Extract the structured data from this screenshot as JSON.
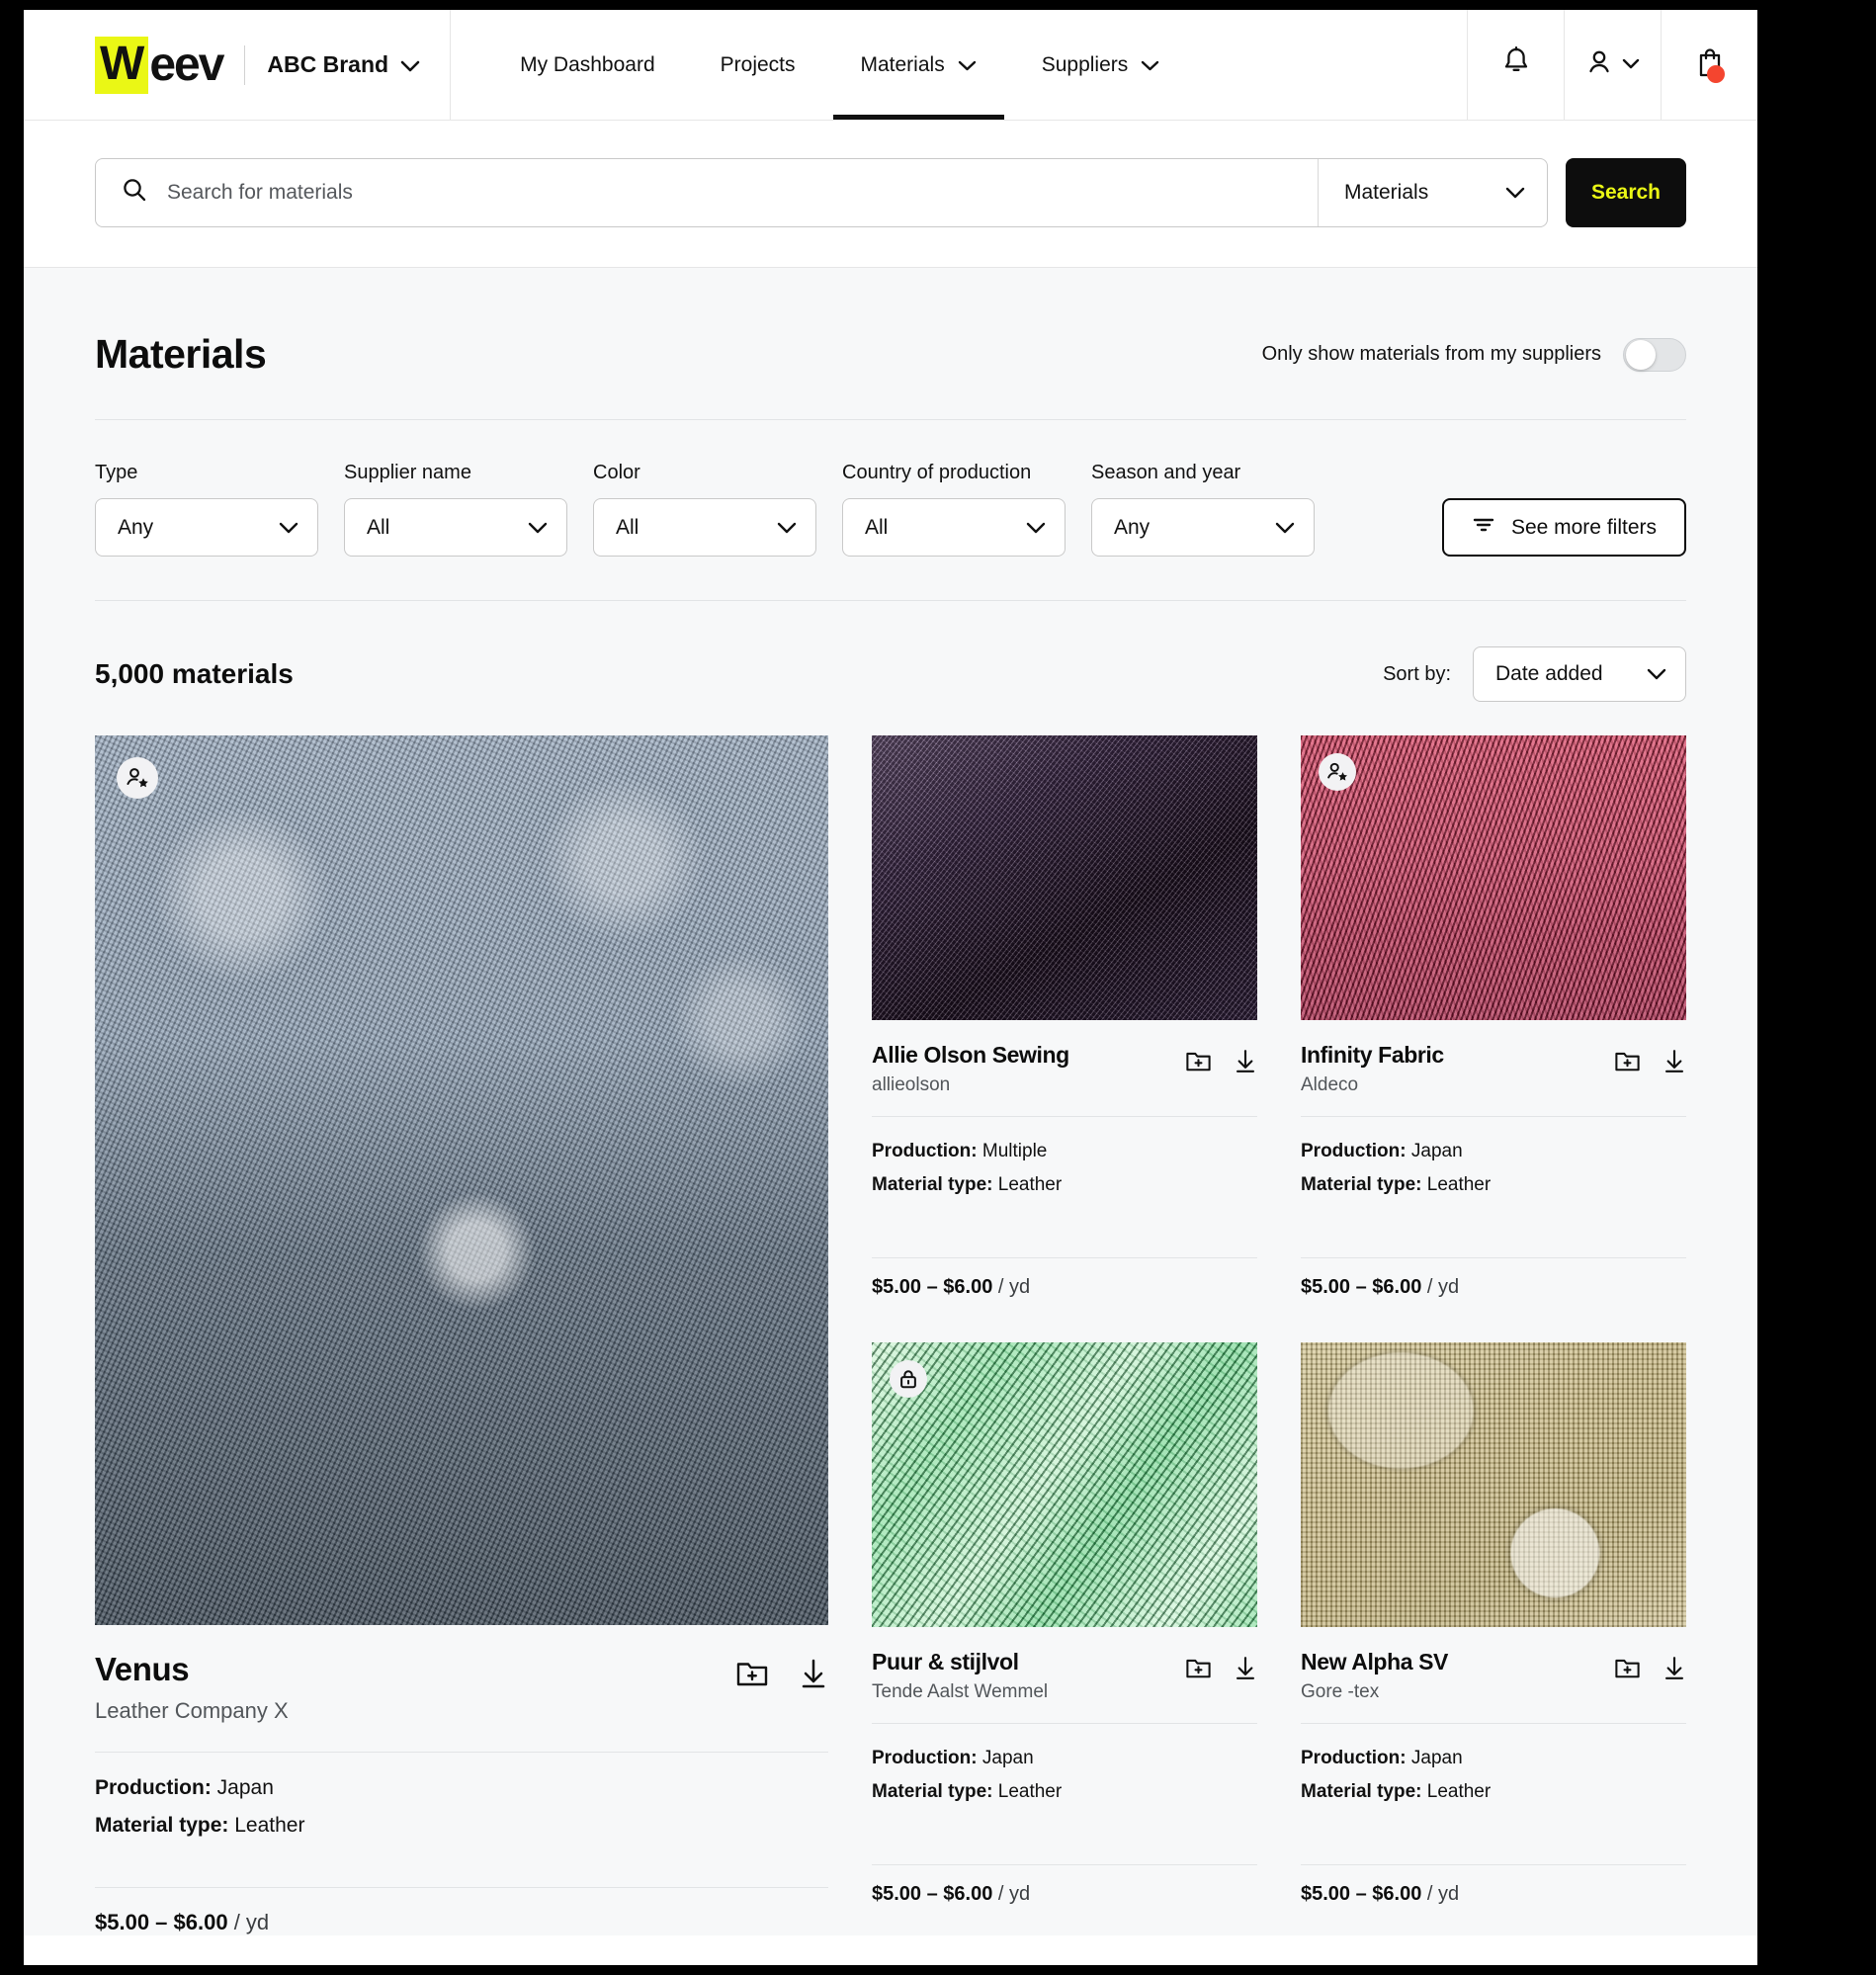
{
  "header": {
    "logo_highlight": "W",
    "logo_rest": "eev",
    "brand": "ABC Brand",
    "nav": [
      {
        "label": "My Dashboard",
        "has_chevron": false,
        "active": false
      },
      {
        "label": "Projects",
        "has_chevron": false,
        "active": false
      },
      {
        "label": "Materials",
        "has_chevron": true,
        "active": true
      },
      {
        "label": "Suppliers",
        "has_chevron": true,
        "active": false
      }
    ],
    "icons": [
      {
        "name": "bell-icon",
        "label": "Notifications"
      },
      {
        "name": "user-icon",
        "label": "Account"
      },
      {
        "name": "bag-icon",
        "label": "Cart",
        "badge": true
      }
    ],
    "accent_yellow": "#eaf715",
    "badge_red": "#f4452f"
  },
  "search": {
    "placeholder": "Search for materials",
    "scope_value": "Materials",
    "button_label": "Search"
  },
  "page": {
    "title": "Materials",
    "supplier_toggle_label": "Only show materials from my suppliers",
    "supplier_toggle_on": false
  },
  "filters": [
    {
      "label": "Type",
      "value": "Any"
    },
    {
      "label": "Supplier name",
      "value": "All"
    },
    {
      "label": "Color",
      "value": "All"
    },
    {
      "label": "Country of production",
      "value": "All"
    },
    {
      "label": "Season and year",
      "value": "Any"
    }
  ],
  "more_filters_label": "See more filters",
  "results": {
    "count_label": "5,000 materials",
    "sort_label": "Sort by:",
    "sort_value": "Date added"
  },
  "labels": {
    "production": "Production:",
    "material_type": "Material type:",
    "unit": "/ yd",
    "add_to_folder": "Add to folder",
    "download": "Download"
  },
  "materials": [
    {
      "name": "Venus",
      "supplier": "Leather Company X",
      "production": "Japan",
      "material_type": "Leather",
      "price": "$5.00 – $6.00",
      "unit": "/ yd",
      "badge": "preferred-supplier-icon",
      "texture": "tex-venus"
    },
    {
      "name": "Allie Olson Sewing",
      "supplier": "allieolson",
      "production": "Multiple",
      "material_type": "Leather",
      "price": "$5.00 – $6.00",
      "unit": "/ yd",
      "badge": null,
      "texture": "tex-purple"
    },
    {
      "name": "Infinity Fabric",
      "supplier": "Aldeco",
      "production": "Japan",
      "material_type": "Leather",
      "price": "$5.00 – $6.00",
      "unit": "/ yd",
      "badge": "preferred-supplier-icon",
      "texture": "tex-pink"
    },
    {
      "name": "Puur & stijlvol",
      "supplier": "Tende Aalst Wemmel",
      "production": "Japan",
      "material_type": "Leather",
      "price": "$5.00 – $6.00",
      "unit": "/ yd",
      "badge": "lock-icon",
      "texture": "tex-green"
    },
    {
      "name": "New Alpha SV",
      "supplier": "Gore -tex",
      "production": "Japan",
      "material_type": "Leather",
      "price": "$5.00 – $6.00",
      "unit": "/ yd",
      "badge": null,
      "texture": "tex-khaki"
    }
  ]
}
